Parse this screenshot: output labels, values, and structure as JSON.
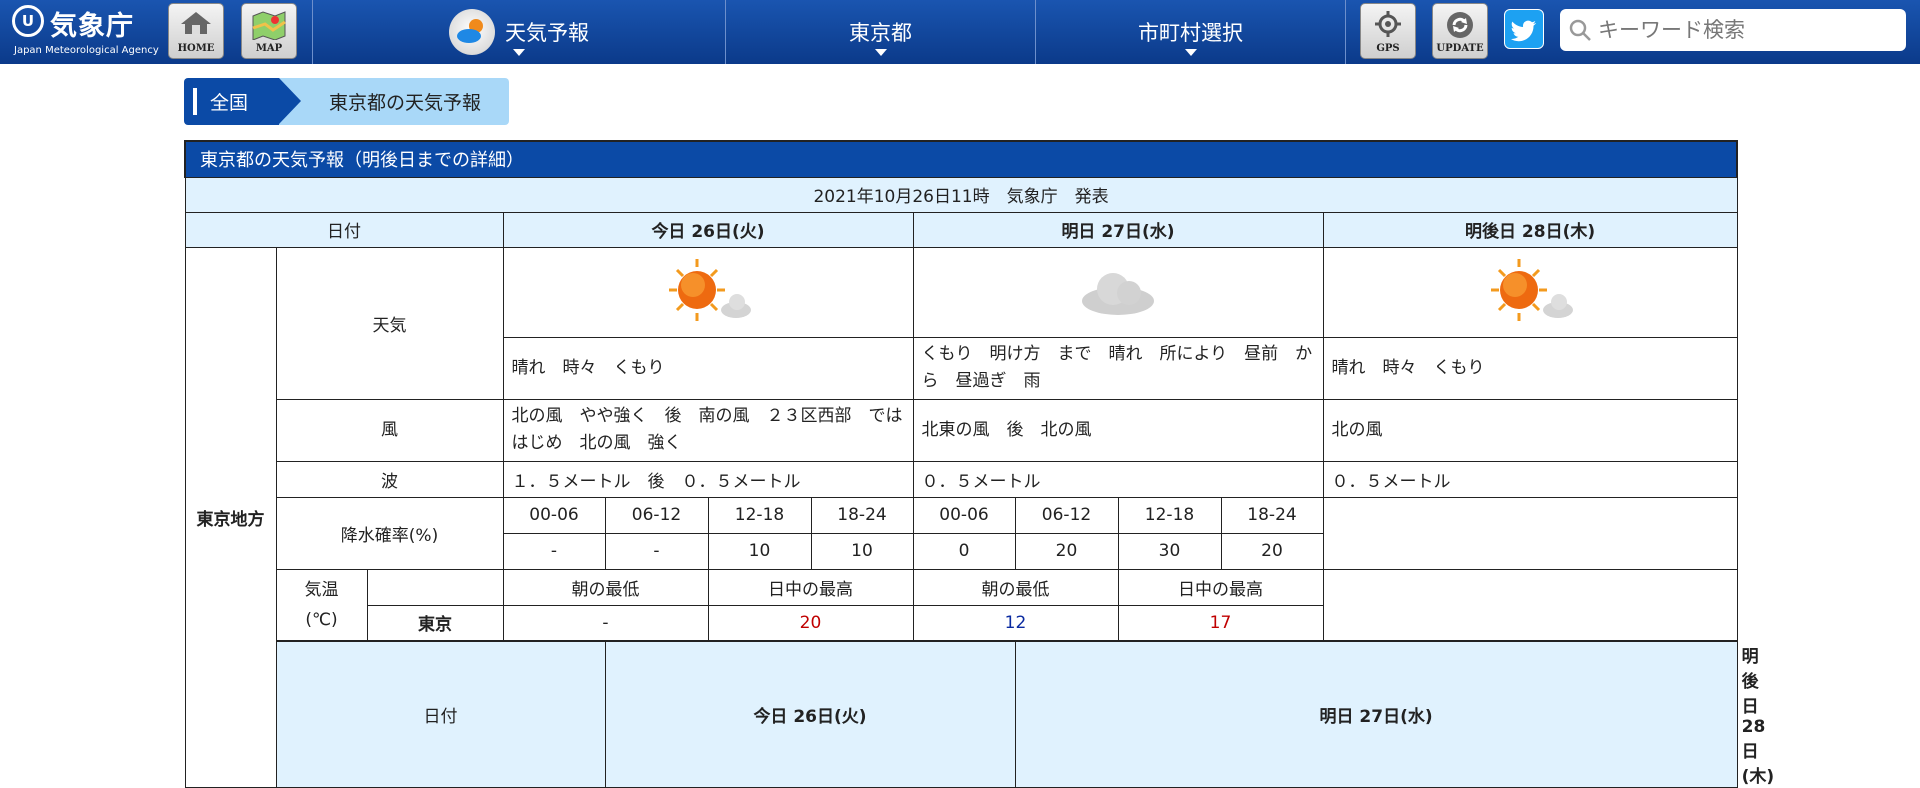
{
  "header": {
    "logo_jp": "気象庁",
    "logo_en": "Japan Meteorological Agency",
    "home_label": "HOME",
    "map_label": "MAP",
    "nav": [
      {
        "label": "天気予報"
      },
      {
        "label": "東京都"
      },
      {
        "label": "市町村選択"
      }
    ],
    "gps_label": "GPS",
    "update_label": "UPDATE",
    "search_placeholder": "キーワード検索"
  },
  "breadcrumb": {
    "home": "全国",
    "current": "東京都の天気予報"
  },
  "forecast": {
    "title": "東京都の天気予報（明後日までの詳細）",
    "issued": "2021年10月26日11時　気象庁　発表",
    "date_label": "日付",
    "days": [
      "今日 26日(火)",
      "明日 27日(水)",
      "明後日 28日(木)"
    ],
    "region": "東京地方",
    "labels": {
      "weather": "天気",
      "wind": "風",
      "wave": "波",
      "pop": "降水確率(%)",
      "temp_line1": "気温",
      "temp_line2": "(℃)"
    },
    "weather_text": [
      "晴れ　時々　くもり",
      "くもり　明け方　まで　晴れ　所により　昼前　から　昼過ぎ　雨",
      "晴れ　時々　くもり"
    ],
    "weather_icons": [
      "sun-cloud-icon",
      "cloud-icon",
      "sun-cloud-icon"
    ],
    "wind_text": [
      "北の風　やや強く　後　南の風　２３区西部　では　はじめ　北の風　強く",
      "北東の風　後　北の風",
      "北の風"
    ],
    "wave_text": [
      "１．５メートル　後　０．５メートル",
      "０．５メートル",
      "０．５メートル"
    ],
    "pop_periods": [
      "00-06",
      "06-12",
      "12-18",
      "18-24",
      "00-06",
      "06-12",
      "12-18",
      "18-24"
    ],
    "pop_values": [
      "-",
      "-",
      "10",
      "10",
      "0",
      "20",
      "30",
      "20"
    ],
    "temp_headers": [
      "朝の最低",
      "日中の最高",
      "朝の最低",
      "日中の最高"
    ],
    "temp_city": "東京",
    "temp_values": [
      "-",
      "20",
      "12",
      "17"
    ],
    "colors": {
      "min": "#0a2aa0",
      "max": "#c00000"
    }
  }
}
